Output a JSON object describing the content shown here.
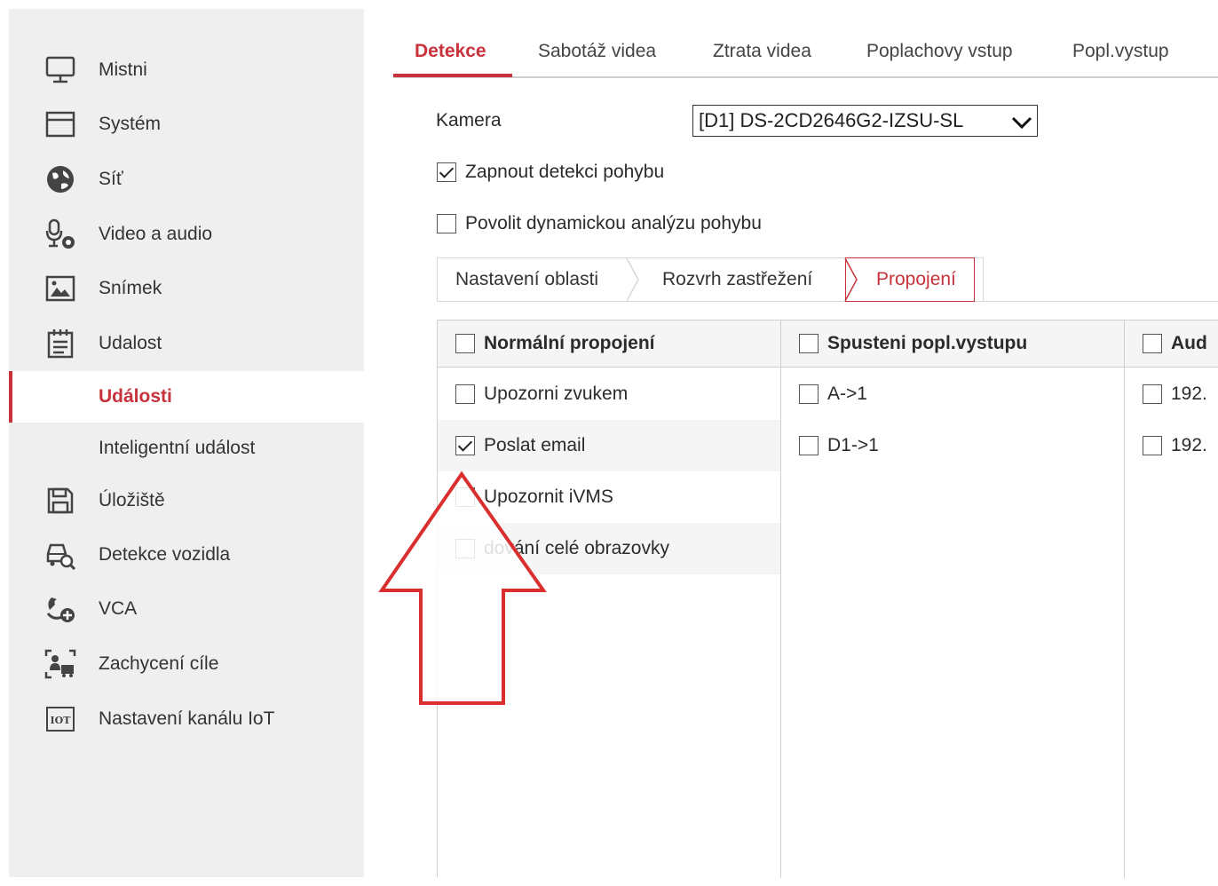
{
  "sidebar": {
    "items": [
      {
        "label": "Mistni",
        "icon": "monitor-icon"
      },
      {
        "label": "Systém",
        "icon": "system-window-icon"
      },
      {
        "label": "Síť",
        "icon": "globe-icon"
      },
      {
        "label": "Video a audio",
        "icon": "microphone-icon"
      },
      {
        "label": "Snímek",
        "icon": "picture-icon"
      },
      {
        "label": "Udalost",
        "icon": "calendar-icon"
      },
      {
        "label": "Události",
        "icon": ""
      },
      {
        "label": "Inteligentní událost",
        "icon": ""
      },
      {
        "label": "Úložiště",
        "icon": "floppy-disk-icon"
      },
      {
        "label": "Detekce vozidla",
        "icon": "car-search-icon"
      },
      {
        "label": "VCA",
        "icon": "vca-icon"
      },
      {
        "label": "Zachycení cíle",
        "icon": "target-capture-icon"
      },
      {
        "label": "Nastavení kanálu IoT",
        "icon": "iot-icon"
      }
    ],
    "active_item": "Události"
  },
  "tabs": [
    {
      "label": "Detekce",
      "active": true
    },
    {
      "label": "Sabotáž videa",
      "active": false
    },
    {
      "label": "Ztrata videa",
      "active": false
    },
    {
      "label": "Poplachovy vstup",
      "active": false
    },
    {
      "label": "Popl.vystup",
      "active": false
    }
  ],
  "form": {
    "camera_label": "Kamera",
    "camera_value": "[D1] DS-2CD2646G2-IZSU-SL",
    "enable_motion": {
      "label": "Zapnout detekci pohybu",
      "checked": true
    },
    "dynamic_analysis": {
      "label": "Povolit dynamickou analýzu pohybu",
      "checked": false
    }
  },
  "subtabs": [
    {
      "label": "Nastavení oblasti",
      "active": false
    },
    {
      "label": "Rozvrh zastřežení",
      "active": false
    },
    {
      "label": "Propojení",
      "active": true
    }
  ],
  "linkage_table": {
    "columns": [
      {
        "header": "Normální propojení",
        "rows": [
          {
            "label": "Upozorni zvukem",
            "checked": false
          },
          {
            "label": "Poslat email",
            "checked": true
          },
          {
            "label": "Upozornit iVMS",
            "checked": false
          },
          {
            "label": "dování celé obrazovky",
            "checked": false
          }
        ]
      },
      {
        "header": "Spusteni popl.vystupu",
        "rows": [
          {
            "label": "A->1",
            "checked": false
          },
          {
            "label": "D1->1",
            "checked": false
          }
        ]
      },
      {
        "header": "Aud",
        "rows": [
          {
            "label": "192.",
            "checked": false
          },
          {
            "label": "192.",
            "checked": false
          }
        ]
      }
    ]
  },
  "colors": {
    "accent": "#c7323b",
    "annotation_arrow": "#d9302f",
    "sidebar_bg": "#efefef"
  }
}
